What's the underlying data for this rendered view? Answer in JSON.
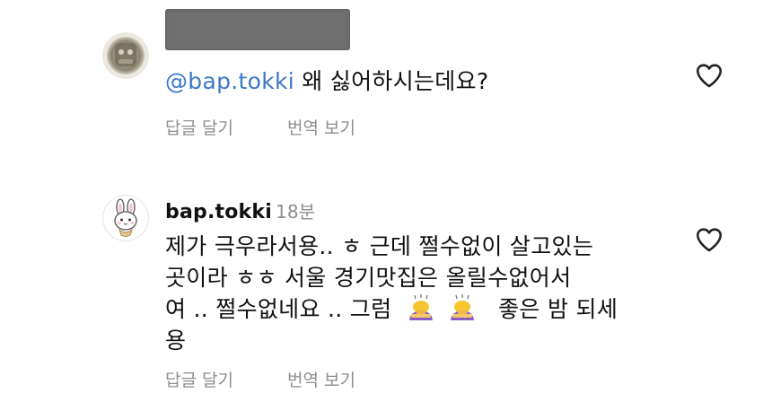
{
  "comments": [
    {
      "username": "",
      "timestamp": "",
      "mention": "@bap.tokki",
      "text": " 왜 싫어하시는데요?",
      "reply_label": "답글 달기",
      "translate_label": "번역 보기",
      "avatar_icon": "profile-photo-icon",
      "like_icon": "heart-outline-icon"
    },
    {
      "username": "bap.tokki",
      "timestamp": "18분",
      "lines": [
        "제가 극우라서용.. ㅎ 근데 쩔수없이 살고있는",
        "곳이라 ㅎㅎ 서울 경기맛집은 올릴수없어서",
        "여 .. 쩔수없네요 .. 그럼",
        "좋은 밤 되세",
        "용"
      ],
      "reply_label": "답글 달기",
      "translate_label": "번역 보기",
      "avatar_icon": "rabbit-avatar-icon",
      "like_icon": "heart-outline-icon",
      "emoji_icon": "woman-bowing-emoji-icon"
    }
  ],
  "colors": {
    "mention": "#3b78c7",
    "secondary_text": "#8e8e8e",
    "primary_text": "#111111",
    "redaction": "#6f6f6f"
  }
}
